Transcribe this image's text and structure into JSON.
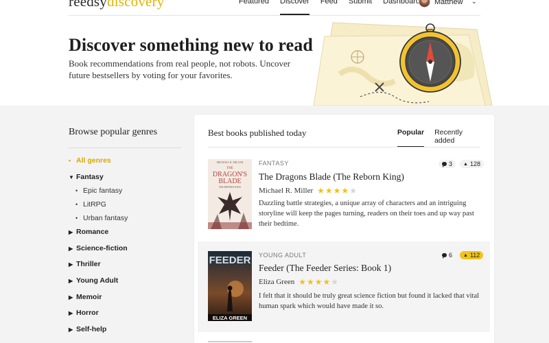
{
  "header": {
    "logo_part1": "reedsy",
    "logo_part2": "discovery",
    "nav": [
      "Featured",
      "Discover",
      "Feed",
      "Submit",
      "Dashboard"
    ],
    "active_nav": "Discover",
    "user_name": "Matthew"
  },
  "hero": {
    "title": "Discover something new to read",
    "subtitle": "Book recommendations from real people, not robots. Uncover future bestsellers by voting for your favorites."
  },
  "sidebar": {
    "heading": "Browse popular genres",
    "items": [
      {
        "label": "All genres",
        "kind": "all"
      },
      {
        "label": "Fantasy",
        "kind": "expanded"
      },
      {
        "label": "Epic fantasy",
        "kind": "sub"
      },
      {
        "label": "LitRPG",
        "kind": "sub"
      },
      {
        "label": "Urban fantasy",
        "kind": "sub"
      },
      {
        "label": "Romance",
        "kind": "collapsed"
      },
      {
        "label": "Science-fiction",
        "kind": "collapsed"
      },
      {
        "label": "Thriller",
        "kind": "collapsed"
      },
      {
        "label": "Young Adult",
        "kind": "collapsed"
      },
      {
        "label": "Memoir",
        "kind": "collapsed"
      },
      {
        "label": "Horror",
        "kind": "collapsed"
      },
      {
        "label": "Self-help",
        "kind": "collapsed"
      }
    ]
  },
  "panel": {
    "title": "Best books published today",
    "tabs": [
      "Popular",
      "Recently added"
    ],
    "active_tab": "Popular",
    "books": [
      {
        "genre": "FANTASY",
        "title": "The Dragons Blade (The Reborn King)",
        "author": "Michael R. Miller",
        "rating": 4,
        "blurb": "Dazzling battle strategies, a unique array of characters and an intriguing storyline will keep the pages turning, readers on their toes and up way past their bedtime.",
        "comments": "3",
        "votes": "128",
        "cover_author": "MICHAEL R. MILLER",
        "cover_title_1": "THE",
        "cover_title_2": "DRAGON'S",
        "cover_title_3": "BLADE",
        "cover_subtitle": "THE REBORN KING"
      },
      {
        "genre": "YOUNG ADULT",
        "title": "Feeder (The Feeder Series: Book 1)",
        "author": "Eliza Green",
        "rating": 4,
        "blurb": "I felt that it should be truly great science fiction but found it lacked that vital human spark which would have made it so.",
        "comments": "6",
        "votes": "112",
        "cover_title": "FEEDER",
        "cover_author": "ELIZA GREEN"
      }
    ]
  },
  "colors": {
    "accent": "#f1c21b",
    "logo_accent": "#e0b400",
    "background_grey": "#f3f3f3"
  }
}
